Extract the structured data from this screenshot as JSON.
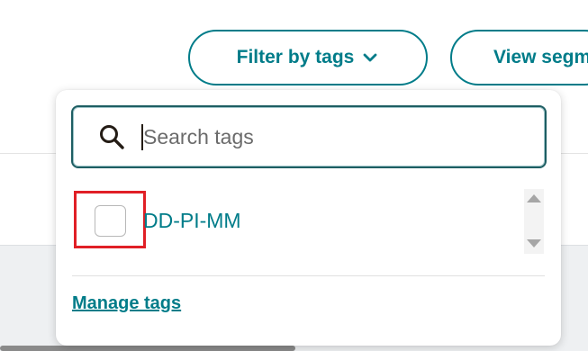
{
  "toolbar": {
    "filter_label": "Filter by tags",
    "view_label": "View segm"
  },
  "dropdown": {
    "search_placeholder": "Search tags",
    "search_value": "",
    "tags": [
      {
        "label": "DD-PI-MM",
        "checked": false
      }
    ],
    "manage_label": "Manage tags"
  },
  "colors": {
    "accent": "#007c89",
    "highlight": "#e01f26",
    "text": "#241c15"
  },
  "icons": [
    "chevron-down-icon",
    "search-icon",
    "scroll-up-icon",
    "scroll-down-icon"
  ]
}
